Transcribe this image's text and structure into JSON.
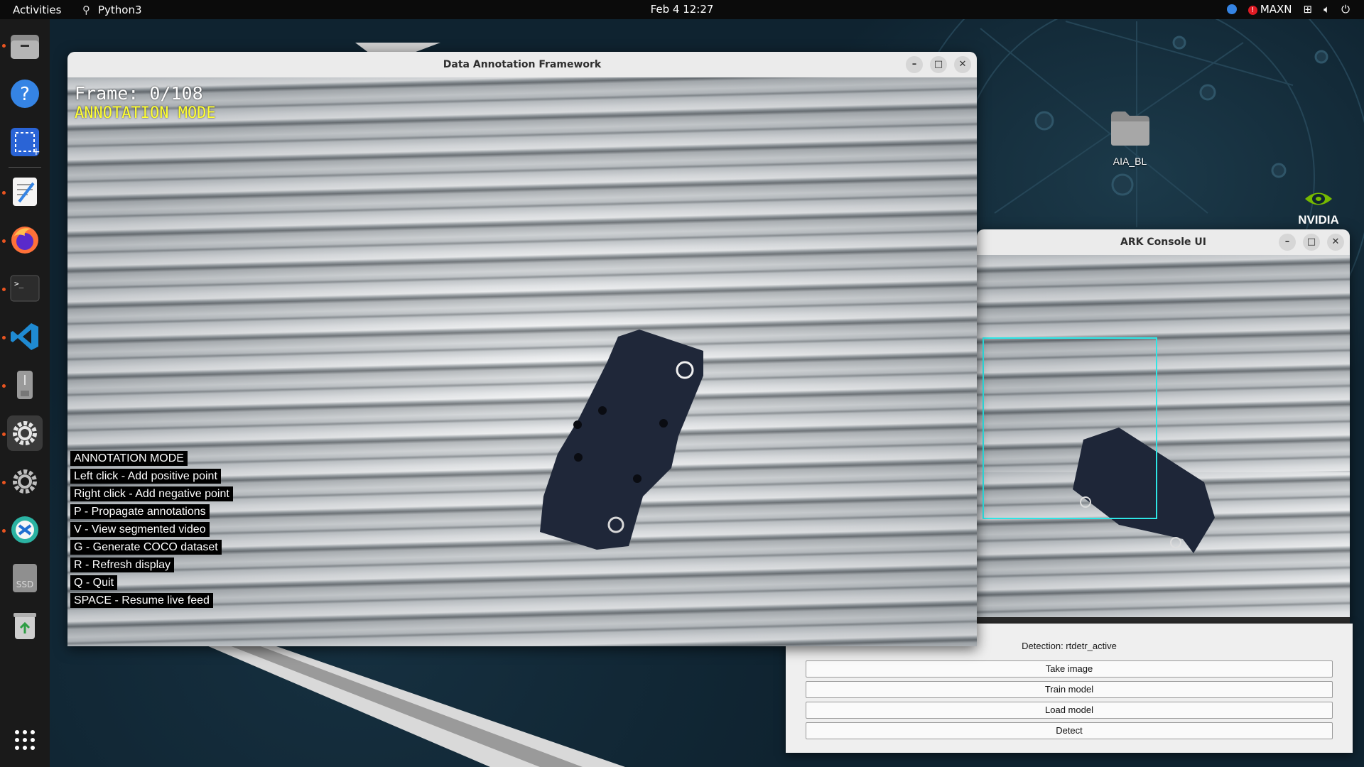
{
  "topbar": {
    "activities": "Activities",
    "app_name": "Python3",
    "clock": "Feb 4  12:27",
    "power_mode": "MAXN"
  },
  "dock": {
    "items": [
      {
        "icon": "files-icon"
      },
      {
        "icon": "help-icon"
      },
      {
        "icon": "screenshot-icon"
      },
      {
        "icon": "text-editor-icon"
      },
      {
        "icon": "firefox-icon"
      },
      {
        "icon": "terminal-icon"
      },
      {
        "icon": "vscode-icon"
      },
      {
        "icon": "usb-drive-icon"
      },
      {
        "icon": "settings-icon"
      },
      {
        "icon": "settings-icon"
      },
      {
        "icon": "software-updater-icon"
      },
      {
        "icon": "ssd-drive-icon",
        "label": "SSD"
      },
      {
        "icon": "trash-icon"
      },
      {
        "icon": "show-apps-icon"
      }
    ]
  },
  "desktop": {
    "folder_label": "AIA_BL",
    "brand": "NVIDIA"
  },
  "annotation_window": {
    "title": "Data Annotation Framework",
    "frame_label": "Frame: 0/108",
    "mode_label": "ANNOTATION MODE",
    "help_lines": [
      "ANNOTATION MODE",
      "Left click - Add positive point",
      "Right click - Add negative point",
      "P - Propagate annotations",
      "V - View segmented video",
      "G - Generate COCO dataset",
      "R - Refresh display",
      "Q - Quit",
      "SPACE - Resume live feed"
    ]
  },
  "ark_window": {
    "title": "ARK Console UI",
    "detection_status": "Detection: rtdetr_active",
    "buttons": [
      "Take image",
      "Train model",
      "Load model",
      "Detect"
    ]
  },
  "colors": {
    "annotation_mode_text": "#ffff33",
    "detection_box": "#2ee6e6",
    "dot_accent": "#e95420"
  }
}
